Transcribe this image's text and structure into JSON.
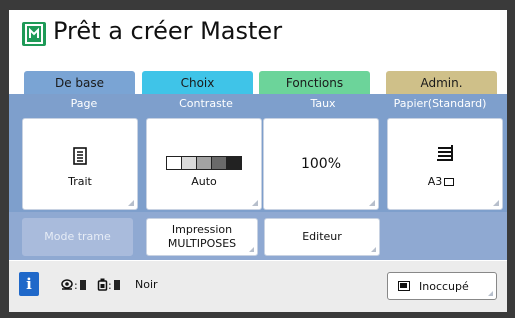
{
  "title": "Prêt a créer Master",
  "colors": {
    "title_icon": "#1e9a57",
    "tab_base": "#7aa4d4",
    "tab_choix": "#3fc4e8",
    "tab_fonctions": "#6cd49a",
    "tab_admin": "#cfc089",
    "panel": "#7e9fcc"
  },
  "tabs": [
    {
      "label": "De base",
      "selected": true
    },
    {
      "label": "Choix"
    },
    {
      "label": "Fonctions"
    },
    {
      "label": "Admin."
    }
  ],
  "settings": [
    {
      "label": "Page",
      "value": "Trait",
      "icon": "document-icon"
    },
    {
      "label": "Contraste",
      "value": "Auto",
      "icon": "contrast-scale-icon"
    },
    {
      "label": "Taux",
      "value": "100%"
    },
    {
      "label": "Papier(Standard)",
      "value": "A3",
      "icon": "paper-tray-icon"
    }
  ],
  "functions": [
    {
      "label": "Mode trame",
      "enabled": false
    },
    {
      "label_line1": "Impression",
      "label_line2": "MULTIPOSES"
    },
    {
      "label": "Editeur"
    }
  ],
  "status": {
    "ink_label": "Noir",
    "state_button": "Inoccupé",
    "icons": [
      "info-icon",
      "drum-icon",
      "ink-icon",
      "idle-icon"
    ]
  }
}
